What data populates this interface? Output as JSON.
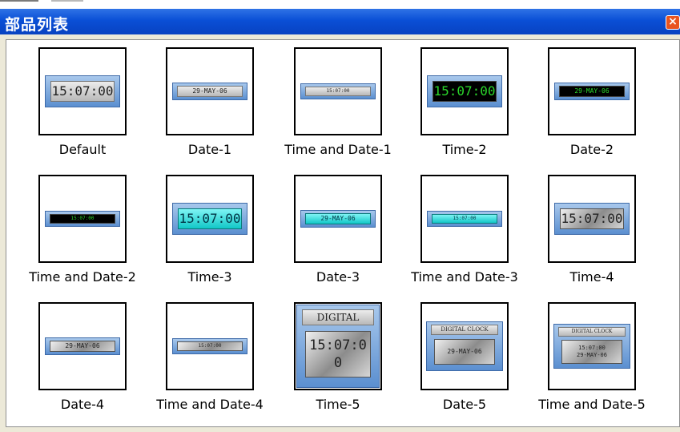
{
  "window": {
    "title": "部品列表",
    "close_glyph": "×"
  },
  "items": [
    {
      "label": "Default",
      "display": "15:07:00"
    },
    {
      "label": "Date-1",
      "display": "29-MAY-06"
    },
    {
      "label": "Time and Date-1",
      "display": "15:07:00"
    },
    {
      "label": "Time-2",
      "display": "15:07:00"
    },
    {
      "label": "Date-2",
      "display": "29-MAY-06"
    },
    {
      "label": "Time and Date-2",
      "display": "15:07:00"
    },
    {
      "label": "Time-3",
      "display": "15:07:00"
    },
    {
      "label": "Date-3",
      "display": "29-MAY-06"
    },
    {
      "label": "Time and Date-3",
      "display": "15:07:00"
    },
    {
      "label": "Time-4",
      "display": "15:07:00"
    },
    {
      "label": "Date-4",
      "display": "29-MAY-06"
    },
    {
      "label": "Time and Date-4",
      "display": "15:07:00"
    },
    {
      "label": "Time-5",
      "header": "DIGITAL",
      "display_line1": "15:07:0",
      "display_line2": "0"
    },
    {
      "label": "Date-5",
      "header": "DIGITAL CLOCK",
      "display": "29-MAY-06"
    },
    {
      "label": "Time and Date-5",
      "header": "DIGITAL CLOCK",
      "display_line1": "15:07:00",
      "display_line2": "29-MAY-06"
    }
  ]
}
